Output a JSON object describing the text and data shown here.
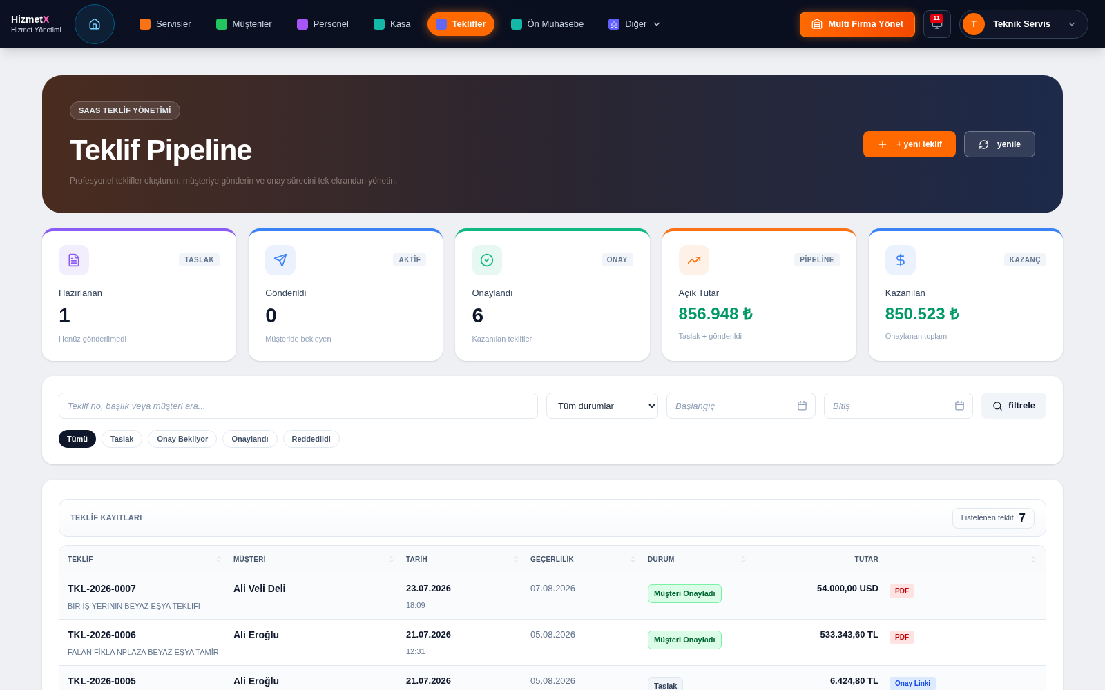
{
  "brand": {
    "name": "Hizmet",
    "mark": "X",
    "subtitle": "Hizmet Yönetimi"
  },
  "nav": [
    {
      "label": "Servisler",
      "color": "#f97316",
      "selected": false
    },
    {
      "label": "Müşteriler",
      "color": "#22c55e",
      "selected": false
    },
    {
      "label": "Personel",
      "color": "#a855f7",
      "selected": false
    },
    {
      "label": "Kasa",
      "color": "#14b8a6",
      "selected": false
    },
    {
      "label": "Teklifler",
      "color": "#6366f1",
      "selected": true
    },
    {
      "label": "Ön Muhasebe",
      "color": "#14b8a6",
      "selected": false
    }
  ],
  "nav_more": {
    "label": "Diğer"
  },
  "multi_button": "Multi Firma Yönet",
  "notifications": {
    "count": "11"
  },
  "user": {
    "initial": "T",
    "name": "Teknik Servis"
  },
  "hero": {
    "badge": "SAAS TEKLİF YÖNETİMİ",
    "title": "Teklif Pipeline",
    "subtitle": "Profesyonel teklifler oluşturun, müşteriye gönderin ve onay sürecini tek ekrandan yönetin.",
    "buttons": [
      {
        "label": "+ yeni teklif",
        "kind": "primary"
      },
      {
        "label": "yenile",
        "kind": "secondary"
      }
    ]
  },
  "stats": [
    {
      "tag": "TASLAK",
      "label": "Hazırlanan",
      "value": "1",
      "note": "Henüz gönderilmedi",
      "color": "#8b5cf6",
      "kind": "count"
    },
    {
      "tag": "AKTİF",
      "label": "Gönderildi",
      "value": "0",
      "note": "Müşteride bekleyen",
      "color": "#3b82f6",
      "kind": "count"
    },
    {
      "tag": "ONAY",
      "label": "Onaylandı",
      "value": "6",
      "note": "Kazanılan teklifler",
      "color": "#10b981",
      "kind": "count"
    },
    {
      "tag": "PİPELİNE",
      "label": "Açık Tutar",
      "value": "856.948 ₺",
      "note": "Taslak + gönderildi",
      "color": "#f97316",
      "kind": "money"
    },
    {
      "tag": "KAZANÇ",
      "label": "Kazanılan",
      "value": "850.523 ₺",
      "note": "Onaylanan toplam",
      "color": "#3b82f6",
      "kind": "money"
    }
  ],
  "filters": {
    "search": {
      "placeholder": "Teklif no, başlık veya müşteri ara..."
    },
    "status_select": {
      "value": "Tüm durumlar"
    },
    "start_date": {
      "placeholder": "Başlangıç"
    },
    "end_date": {
      "placeholder": "Bitiş"
    },
    "button": "filtrele",
    "chips": [
      {
        "label": "Tümü",
        "selected": true
      },
      {
        "label": "Taslak",
        "selected": false
      },
      {
        "label": "Onay Bekliyor",
        "selected": false
      },
      {
        "label": "Onaylandı",
        "selected": false
      },
      {
        "label": "Reddedildi",
        "selected": false
      }
    ]
  },
  "table": {
    "title": "TEKLİF KAYITLARI",
    "count_label": "Listelenen teklif",
    "count": "7",
    "columns": [
      "TEKLİF",
      "MÜŞTERİ",
      "TARİH",
      "GEÇERLİLİK",
      "DURUM",
      "TUTAR"
    ],
    "rows": [
      {
        "number": "TKL-2026-0007",
        "title": "BİR İŞ YERİNİN BEYAZ EŞYA TEKLİFİ",
        "customer": "Ali Veli Deli",
        "date": "23.07.2026",
        "time": "18:09",
        "valid": "07.08.2026",
        "status": {
          "text": "Müşteri Onayladı",
          "kind": "approved"
        },
        "amount": "54.000,00 USD",
        "action": {
          "text": "PDF",
          "kind": "pdf"
        }
      },
      {
        "number": "TKL-2026-0006",
        "title": "FALAN FİKLA NPLAZA BEYAZ EŞYA TAMİR",
        "customer": "Ali Eroğlu",
        "date": "21.07.2026",
        "time": "12:31",
        "valid": "05.08.2026",
        "status": {
          "text": "Müşteri Onayladı",
          "kind": "approved"
        },
        "amount": "533.343,60 TL",
        "action": {
          "text": "PDF",
          "kind": "pdf"
        }
      },
      {
        "number": "TKL-2026-0005",
        "customer": "Ali Eroğlu",
        "date": "21.07.2026",
        "valid": "05.08.2026",
        "status": {
          "text": "Taslak",
          "kind": "draft"
        },
        "amount": "6.424,80 TL",
        "action": {
          "text": "Onay Linki",
          "kind": "link"
        }
      }
    ]
  }
}
